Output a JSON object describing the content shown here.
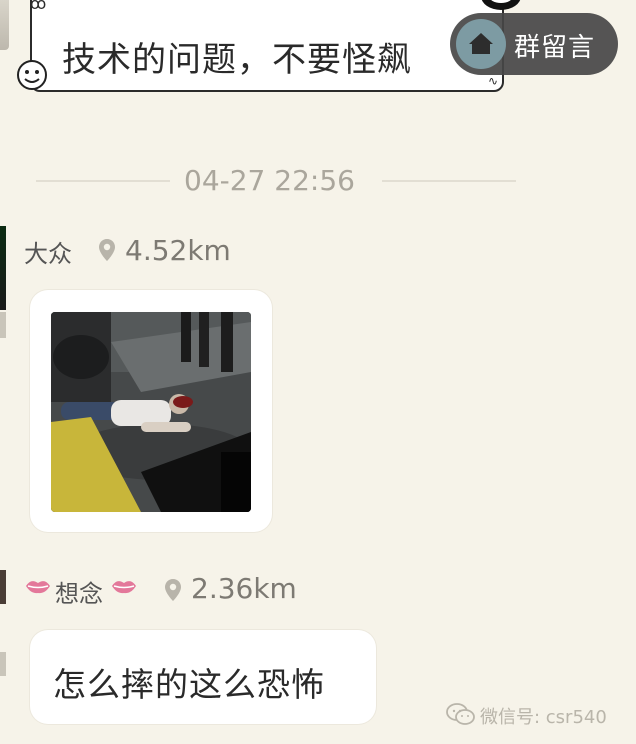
{
  "top_message": {
    "text": "技术的问题，不要怪飙"
  },
  "group_button": {
    "label": "群留言",
    "icon": "home-icon"
  },
  "timestamp": "04-27 22:56",
  "messages": [
    {
      "user": "大众",
      "distance": "4.52km",
      "type": "image",
      "icon": "location-pin-icon"
    },
    {
      "user": "想念",
      "user_decoration": "lips-icon",
      "distance": "2.36km",
      "type": "text",
      "text": "怎么摔的这么恐怖",
      "icon": "location-pin-icon"
    }
  ],
  "watermark": {
    "text": "微信号: csr540",
    "icon": "wechat-icon"
  },
  "colors": {
    "background": "#f6f3e9",
    "bubble": "#ffffff",
    "group_pill": "#464646",
    "home_circle": "#7d9ba3",
    "timestamp": "#aaa69c",
    "distance": "#7d7a73",
    "lips": "#e3789a"
  }
}
